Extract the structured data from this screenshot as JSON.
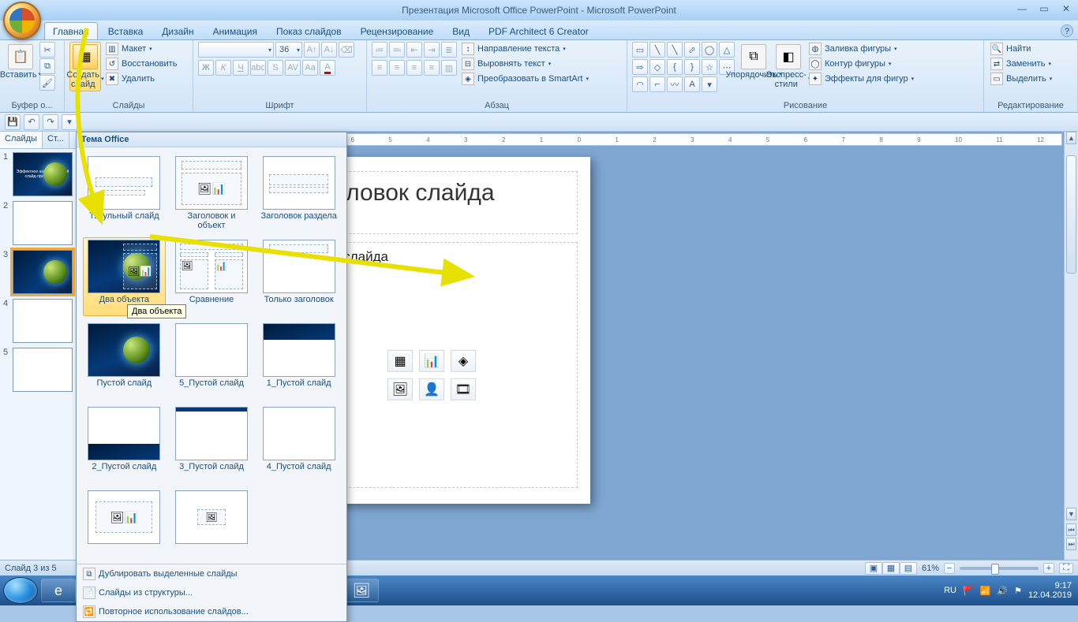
{
  "app": {
    "title": "Презентация Microsoft Office PowerPoint - Microsoft PowerPoint"
  },
  "tabs": [
    "Главная",
    "Вставка",
    "Дизайн",
    "Анимация",
    "Показ слайдов",
    "Рецензирование",
    "Вид",
    "PDF Architect 6 Creator"
  ],
  "activeTab": 0,
  "ribbon": {
    "clipboard": {
      "label": "Буфер о...",
      "paste": "Вставить"
    },
    "slides": {
      "label": "Слайды",
      "new": "Создать слайд",
      "layout": "Макет",
      "reset": "Восстановить",
      "delete": "Удалить"
    },
    "font": {
      "label": "Шрифт",
      "size": "36"
    },
    "paragraph": {
      "label": "Абзац",
      "dir": "Направление текста",
      "align": "Выровнять текст",
      "smartart": "Преобразовать в SmartArt"
    },
    "drawing": {
      "label": "Рисование",
      "arrange": "Упорядочить",
      "styles": "Экспресс-стили",
      "fill": "Заливка фигуры",
      "outline": "Контур фигуры",
      "effects": "Эффекты для фигур"
    },
    "editing": {
      "label": "Редактирование",
      "find": "Найти",
      "replace": "Заменить",
      "select": "Выделить"
    }
  },
  "panes": {
    "slides": "Слайды",
    "outline": "Ст..."
  },
  "gallery": {
    "header": "Тема Office",
    "layouts": [
      "Титульный слайд",
      "Заголовок и объект",
      "Заголовок раздела",
      "Два объекта",
      "Сравнение",
      "Только заголовок",
      "Пустой слайд",
      "5_Пустой слайд",
      "1_Пустой слайд",
      "2_Пустой слайд",
      "3_Пустой слайд",
      "4_Пустой слайд",
      "",
      ""
    ],
    "tooltip": "Два объекта",
    "footer": [
      "Дублировать выделенные слайды",
      "Слайды из структуры...",
      "Повторное использование слайдов..."
    ]
  },
  "slide": {
    "title": "Заголовок слайда",
    "body": "Текст слайда"
  },
  "status": {
    "left": "Слайд 3 из 5",
    "zoom": "61%"
  },
  "ruler": [
    "12",
    "11",
    "10",
    "9",
    "8",
    "7",
    "6",
    "5",
    "4",
    "3",
    "2",
    "1",
    "0",
    "1",
    "2",
    "3",
    "4",
    "5",
    "6",
    "7",
    "8",
    "9",
    "10",
    "11",
    "12"
  ],
  "tray": {
    "lang": "RU",
    "time": "9:17",
    "date": "12.04.2019"
  },
  "thumbs": [
    {
      "n": "1",
      "dark": true,
      "text": "Эффектное название вашей слайд-презентации"
    },
    {
      "n": "2",
      "dark": false
    },
    {
      "n": "3",
      "dark": true,
      "sel": true
    },
    {
      "n": "4",
      "dark": false
    },
    {
      "n": "5",
      "dark": false
    }
  ]
}
